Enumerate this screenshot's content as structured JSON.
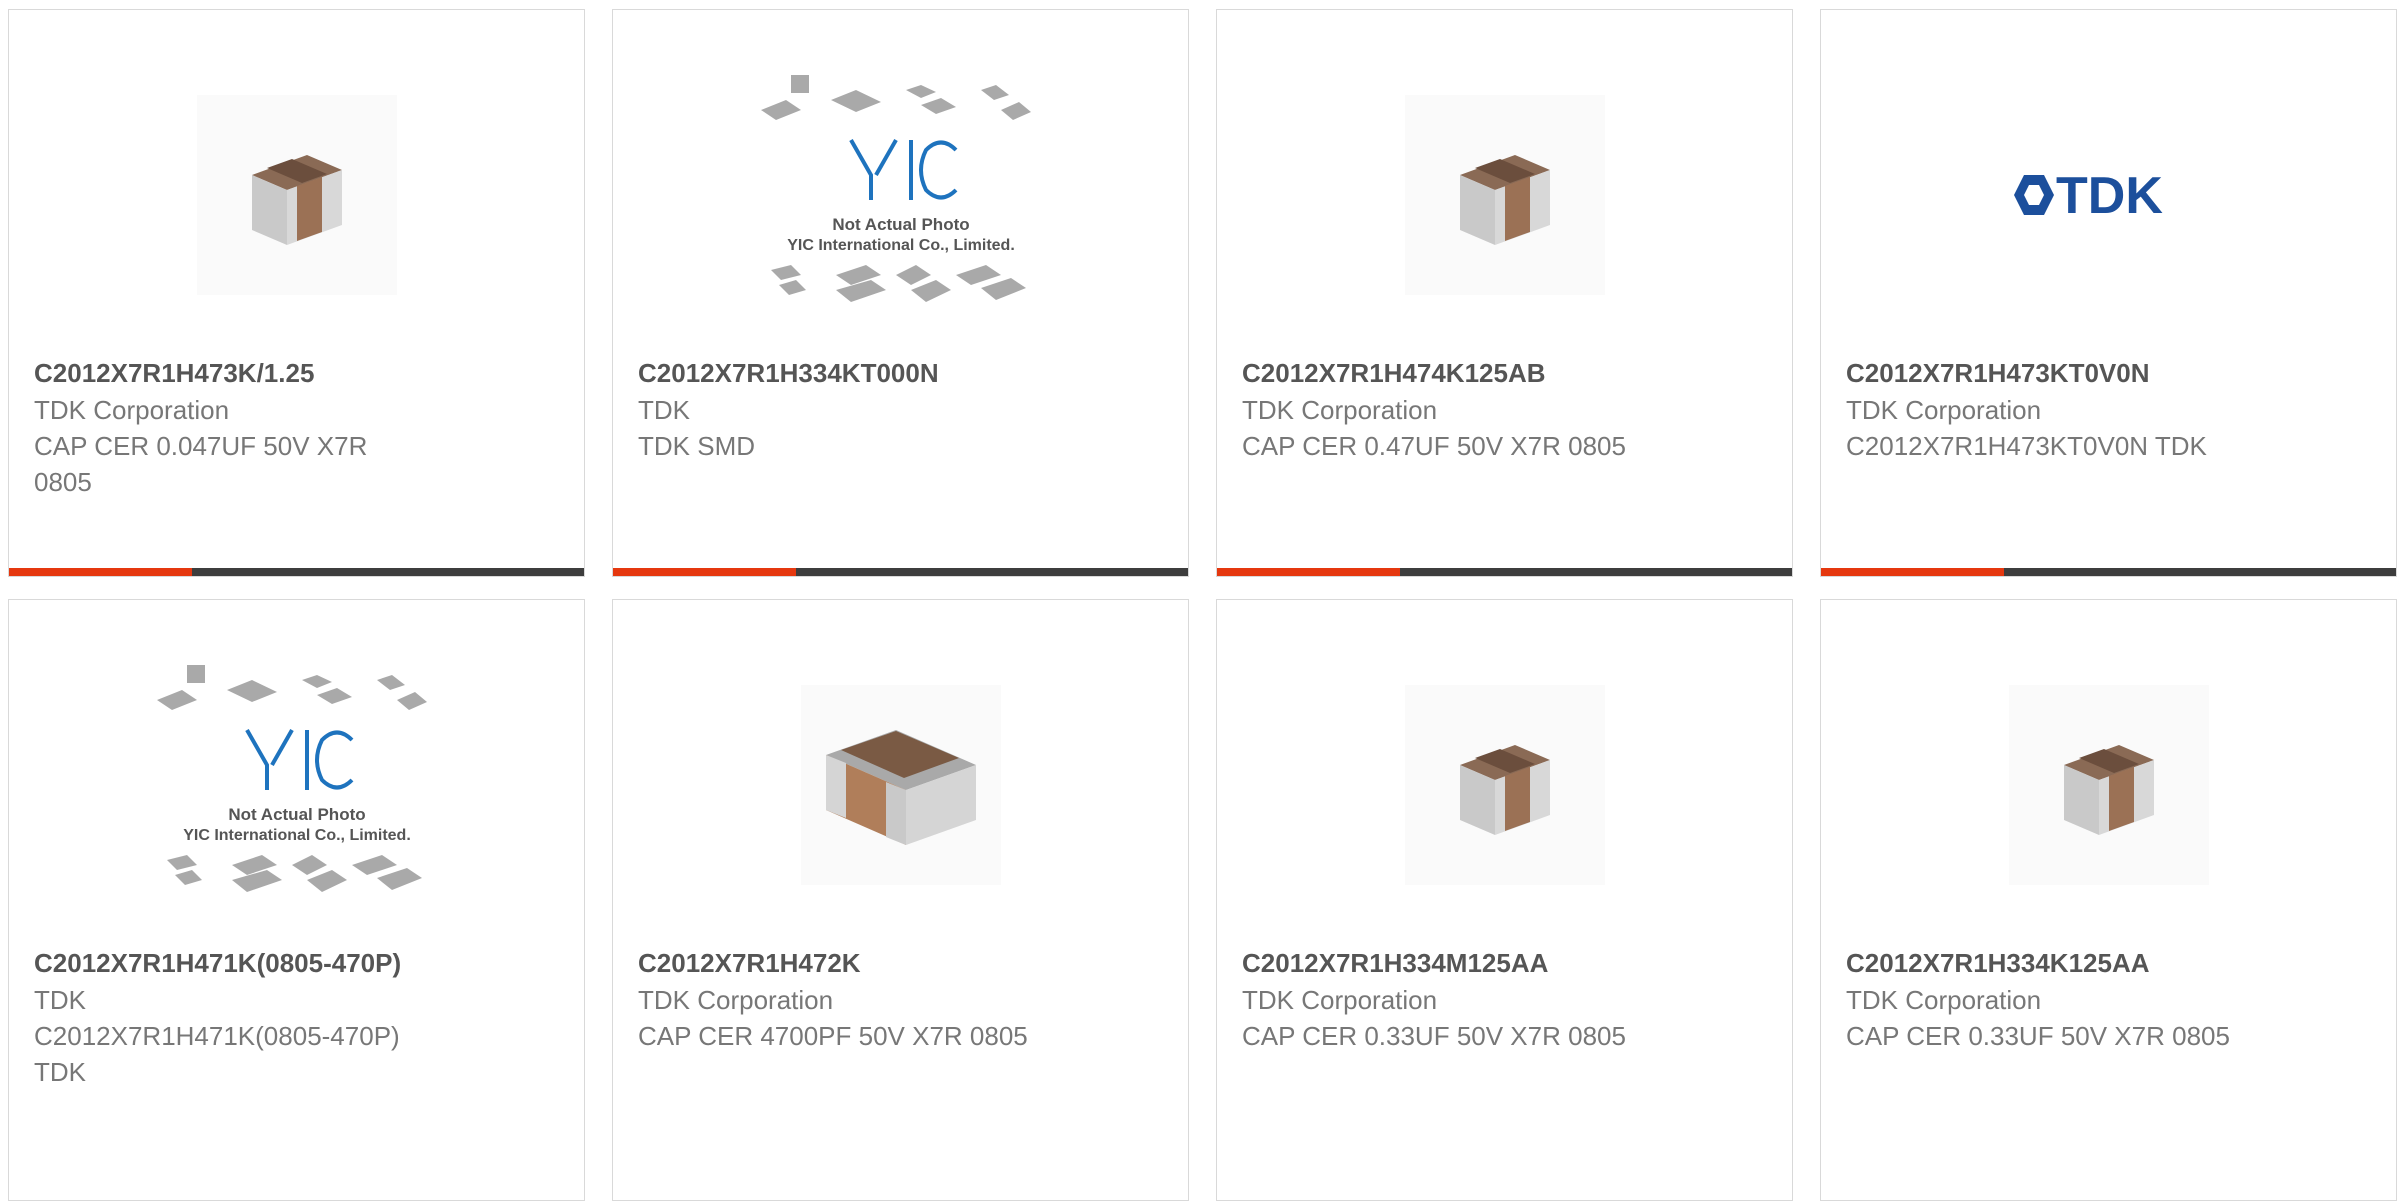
{
  "colors": {
    "accent": "#e5380f",
    "bar": "#3d3d3d",
    "capacitor_body": "#9b7155",
    "yic_blue": "#1e73be",
    "tdk_blue": "#1c4f9c"
  },
  "products": [
    {
      "part": "C2012X7R1H473K/1.25",
      "manufacturer": "TDK Corporation",
      "description": "CAP CER 0.047UF 50V X7R 0805",
      "image": "capacitor-photo"
    },
    {
      "part": "C2012X7R1H334KT000N",
      "manufacturer": "TDK",
      "description": "TDK SMD",
      "image": "yic-placeholder",
      "placeholder_text_1": "Not Actual Photo",
      "placeholder_text_2": "YIC International Co., Limited.",
      "logo_text": "YIC"
    },
    {
      "part": "C2012X7R1H474K125AB",
      "manufacturer": "TDK Corporation",
      "description": "CAP CER 0.47UF 50V X7R 0805",
      "image": "capacitor-photo"
    },
    {
      "part": "C2012X7R1H473KT0V0N",
      "manufacturer": "TDK Corporation",
      "description": "C2012X7R1H473KT0V0N TDK",
      "image": "tdk-logo",
      "logo_text": "TDK"
    },
    {
      "part": "C2012X7R1H471K(0805-470P)",
      "manufacturer": "TDK",
      "description": "C2012X7R1H471K(0805-470P) TDK",
      "image": "yic-placeholder",
      "placeholder_text_1": "Not Actual Photo",
      "placeholder_text_2": "YIC International Co., Limited.",
      "logo_text": "YIC"
    },
    {
      "part": "C2012X7R1H472K",
      "manufacturer": "TDK Corporation",
      "description": "CAP CER 4700PF 50V X7R 0805",
      "image": "capacitor-photo-large"
    },
    {
      "part": "C2012X7R1H334M125AA",
      "manufacturer": "TDK Corporation",
      "description": "CAP CER 0.33UF 50V X7R 0805",
      "image": "capacitor-photo"
    },
    {
      "part": "C2012X7R1H334K125AA",
      "manufacturer": "TDK Corporation",
      "description": "CAP CER 0.33UF 50V X7R 0805",
      "image": "capacitor-photo"
    }
  ]
}
